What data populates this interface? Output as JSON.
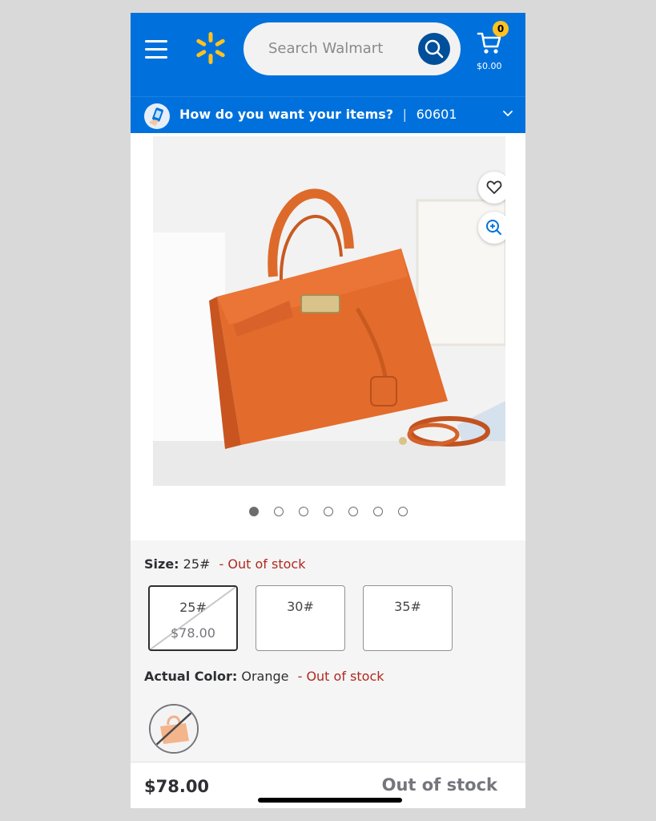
{
  "colors": {
    "brand_blue": "#0071dc",
    "spark_yellow": "#ffc220",
    "out_of_stock_red": "#b0291f"
  },
  "header": {
    "search_placeholder": "Search Walmart",
    "cart_count": "0",
    "cart_total": "$0.00"
  },
  "delivery": {
    "question": "How do you want your items?",
    "separator": "|",
    "zip": "60601"
  },
  "gallery": {
    "image_count": 7,
    "active_index": 0
  },
  "size": {
    "label": "Size:",
    "selected": "25#",
    "status": "- Out of stock",
    "options": [
      {
        "name": "25#",
        "price": "$78.00"
      },
      {
        "name": "30#"
      },
      {
        "name": "35#"
      }
    ]
  },
  "color": {
    "label": "Actual Color:",
    "selected": "Orange",
    "status": "- Out of stock"
  },
  "footer": {
    "price": "$78.00",
    "availability": "Out of stock"
  }
}
